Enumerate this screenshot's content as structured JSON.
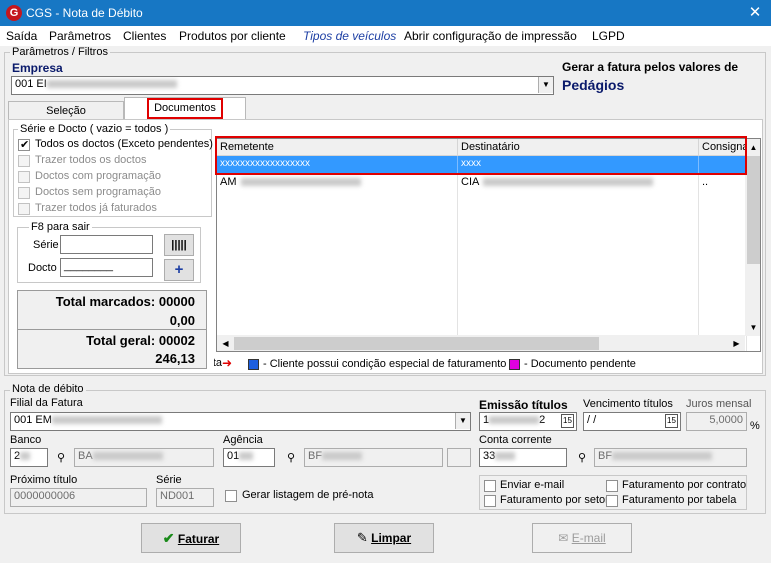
{
  "window": {
    "title": "CGS - Nota de Débito",
    "logo_letter": "G"
  },
  "menu": [
    {
      "label": "Saída"
    },
    {
      "label": "Parâmetros"
    },
    {
      "label": "Clientes"
    },
    {
      "label": "Produtos por cliente"
    },
    {
      "label": "Tipos de veículos"
    },
    {
      "label": "Abrir configuração de impressão"
    },
    {
      "label": "LGPD"
    }
  ],
  "filters": {
    "group_label": "Parâmetros / Filtros",
    "empresa_label": "Empresa",
    "empresa_value": "001 EI",
    "gerar_label": "Gerar a fatura pelos valores de",
    "gerar_value": "Pedágios"
  },
  "tabs": [
    {
      "label": "Seleção"
    },
    {
      "label": "Documentos"
    }
  ],
  "serie_group": {
    "label": "Série e Docto  ( vazio = todos )",
    "options": [
      {
        "label": "Todos os doctos (Exceto pendentes)",
        "checked": true,
        "enabled": true
      },
      {
        "label": "Trazer todos os doctos",
        "checked": false,
        "enabled": false
      },
      {
        "label": "Doctos com programação",
        "checked": false,
        "enabled": false
      },
      {
        "label": "Doctos sem programação",
        "checked": false,
        "enabled": false
      },
      {
        "label": "Trazer todos já faturados",
        "checked": false,
        "enabled": false
      }
    ],
    "f8_label": "F8 para sair",
    "serie_label": "Série",
    "docto_label": "Docto",
    "docto_value": "________"
  },
  "totals": {
    "marcados_label": "Total marcados:",
    "marcados_count": "00000",
    "marcados_value": "0,00",
    "geral_label": "Total geral:",
    "geral_count": "00002",
    "geral_value": "246,13"
  },
  "grid": {
    "columns": [
      "Remetente",
      "Destinatário",
      "Consigna"
    ],
    "rows": [
      [
        "xxxxxxxxxxxxxxxxxx",
        "xxxx",
        ""
      ],
      [
        "AM",
        "CIA",
        ".."
      ]
    ]
  },
  "legend": {
    "prefix": "nsulta",
    "item1": "- Cliente possui condição especial de faturamento",
    "item1_color": "#1e5fe0",
    "item2": "- Documento pendente",
    "item2_color": "#e000e0"
  },
  "nota": {
    "group_label": "Nota de débito",
    "filial_label": "Filial da Fatura",
    "filial_value": "001 EM",
    "emissao_label": "Emissão títulos",
    "emissao_value_a": "1",
    "emissao_value_b": "2",
    "vencimento_label": "Vencimento títulos",
    "vencimento_value": " / /",
    "juros_label": "Juros mensal",
    "juros_value": "5,0000",
    "juros_unit": "%",
    "banco_label": "Banco",
    "banco_code": "2",
    "banco_name": "BA",
    "agencia_label": "Agência",
    "agencia_code": "01",
    "agencia_name": "BF",
    "conta_label": "Conta corrente",
    "conta_code": "33",
    "conta_name": "BF",
    "proximo_label": "Próximo título",
    "proximo_value": "0000000006",
    "serie_label": "Série",
    "serie_value": "ND001",
    "gerar_listagem_label": "Gerar listagem de pré-nota",
    "checks": {
      "enviar_email": "Enviar e-mail",
      "fat_contrato": "Faturamento por contrato",
      "fat_setor": "Faturamento por setor",
      "fat_tabela": "Faturamento por tabela"
    },
    "calendar_icon_text": "15"
  },
  "buttons": {
    "faturar": "Faturar",
    "limpar": "Limpar",
    "email": "E-mail"
  }
}
